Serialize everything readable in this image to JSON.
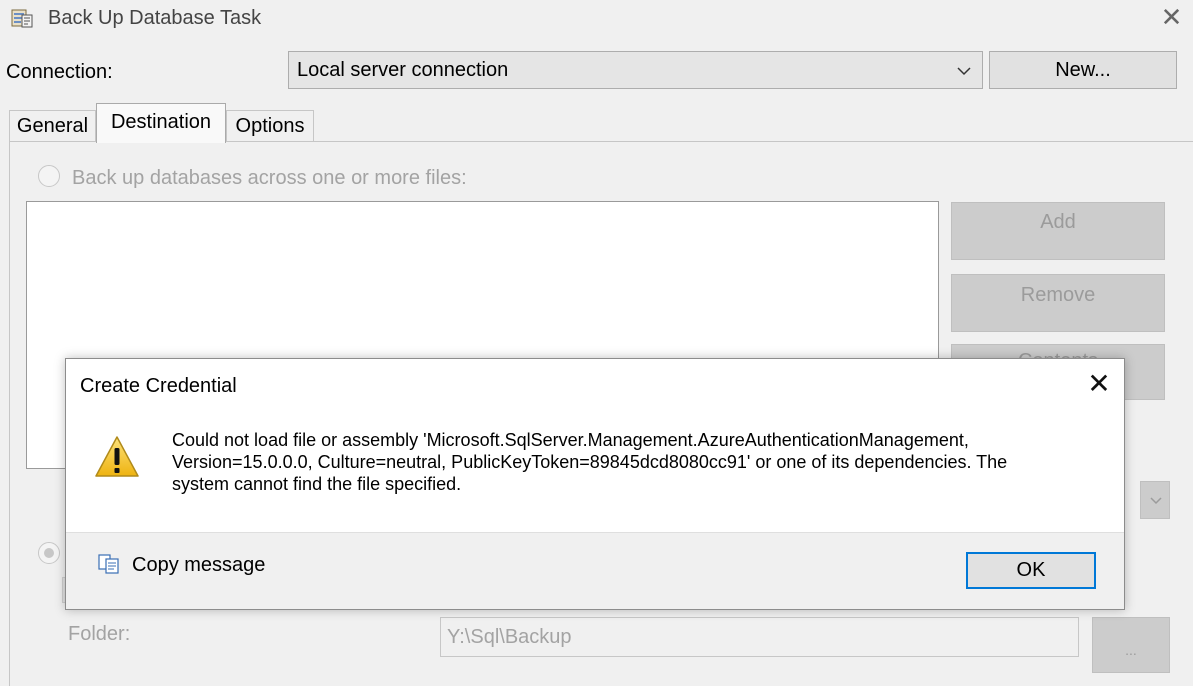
{
  "window": {
    "title": "Back Up Database Task",
    "close_glyph": "✕"
  },
  "connection": {
    "label": "Connection:",
    "selected": "Local server connection",
    "new_button": "New..."
  },
  "tabs": [
    {
      "label": "General"
    },
    {
      "label": "Destination",
      "active": true
    },
    {
      "label": "Options"
    }
  ],
  "destination": {
    "radio_files_label": "Back up databases across one or more files:",
    "add_button": "Add",
    "remove_button": "Remove",
    "contents_button": "Contents",
    "folder_label": "Folder:",
    "folder_value": "Y:\\Sql\\Backup",
    "browse_button": "..."
  },
  "dialog": {
    "title": "Create Credential",
    "close_glyph": "✕",
    "message_lines": [
      "Could not load file or assembly 'Microsoft.SqlServer.Management.AzureAuthenticationManagement,",
      "Version=15.0.0.0, Culture=neutral, PublicKeyToken=89845dcd8080cc91' or one of its dependencies. The",
      "system cannot find the file specified."
    ],
    "copy_label": "Copy message",
    "ok_button": "OK"
  },
  "colors": {
    "accent": "#0078d7",
    "warning": "#f5c518"
  },
  "icons": {
    "title": "task-icon",
    "warning": "warning-icon",
    "copy": "copy-icon",
    "dropdown": "chevron-down-icon"
  }
}
